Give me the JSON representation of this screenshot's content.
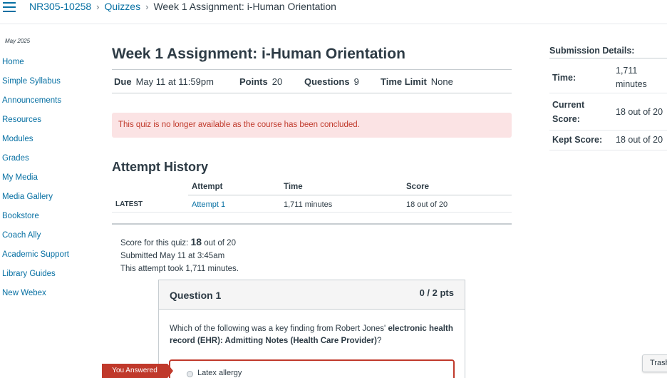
{
  "breadcrumb": {
    "course": "NR305-10258",
    "section": "Quizzes",
    "current": "Week 1 Assignment: i-Human Orientation",
    "separator": "›"
  },
  "sidebar": {
    "term": "May 2025",
    "items": [
      {
        "label": "Home"
      },
      {
        "label": "Simple Syllabus"
      },
      {
        "label": "Announcements"
      },
      {
        "label": "Resources"
      },
      {
        "label": "Modules"
      },
      {
        "label": "Grades"
      },
      {
        "label": "My Media"
      },
      {
        "label": "Media Gallery"
      },
      {
        "label": "Bookstore"
      },
      {
        "label": "Coach Ally"
      },
      {
        "label": "Academic Support"
      },
      {
        "label": "Library Guides"
      },
      {
        "label": "New Webex"
      }
    ]
  },
  "quiz": {
    "title": "Week 1 Assignment: i-Human Orientation",
    "due_label": "Due",
    "due_value": "May 11 at 11:59pm",
    "points_label": "Points",
    "points_value": "20",
    "questions_label": "Questions",
    "questions_value": "9",
    "time_limit_label": "Time Limit",
    "time_limit_value": "None",
    "alert": "This quiz is no longer available as the course has been concluded."
  },
  "history": {
    "title": "Attempt History",
    "columns": [
      "Attempt",
      "Time",
      "Score"
    ],
    "rows": [
      {
        "label": "LATEST",
        "attempt": "Attempt 1",
        "time": "1,711 minutes",
        "score": "18 out of 20"
      }
    ]
  },
  "summary": {
    "score_prefix": "Score for this quiz:",
    "score": "18",
    "score_suffix": "out of 20",
    "submitted": "Submitted May 11 at 3:45am",
    "took": "This attempt took 1,711 minutes."
  },
  "question": {
    "title": "Question 1",
    "points": "0 / 2 pts",
    "text_plain": "Which of the following was a key finding from Robert Jones'",
    "text_bold": "electronic health record (EHR): Admitting Notes (Health Care Provider)",
    "text_end": "?",
    "you_answered": "You Answered",
    "answer": "Latex allergy"
  },
  "submission": {
    "title": "Submission Details:",
    "time_label": "Time:",
    "time_value_1": "1,711",
    "time_value_2": "minutes",
    "current_label_1": "Current",
    "current_label_2": "Score:",
    "current_value": "18 out of 20",
    "kept_label": "Kept Score:",
    "kept_value": "18 out of 20"
  },
  "trash_label": "Trash"
}
